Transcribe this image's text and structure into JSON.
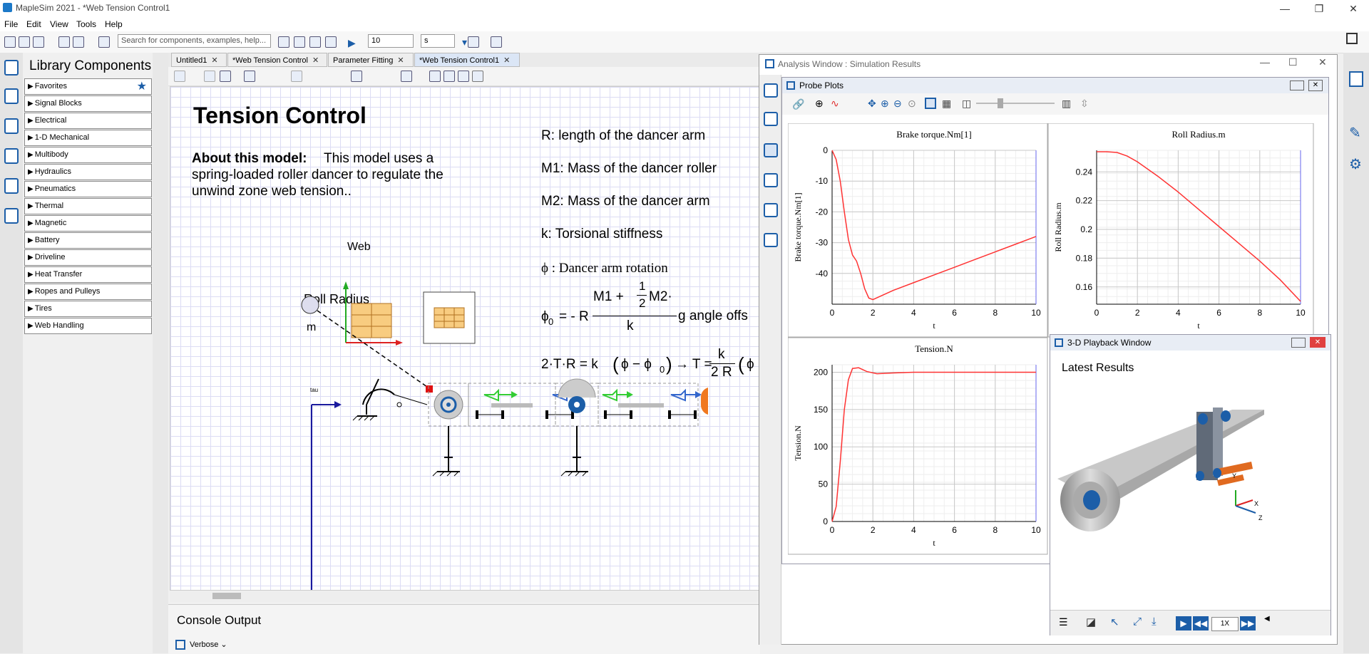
{
  "window": {
    "title": "MapleSim 2021 - *Web Tension Control1"
  },
  "menu": [
    "File",
    "Edit",
    "View",
    "Tools",
    "Help"
  ],
  "toolbar": {
    "search_placeholder": "Search for components, examples, help...",
    "sim_time": "10",
    "sim_units": "s"
  },
  "library": {
    "title": "Library Components",
    "items": [
      "Favorites",
      "Signal Blocks",
      "Electrical",
      "1-D Mechanical",
      "Multibody",
      "Hydraulics",
      "Pneumatics",
      "Thermal",
      "Magnetic",
      "Battery",
      "Driveline",
      "Heat Transfer",
      "Ropes and Pulleys",
      "Tires",
      "Web Handling"
    ]
  },
  "tabs": [
    {
      "label": "Untitled1",
      "close": "✕"
    },
    {
      "label": "*Web Tension Control",
      "close": "✕"
    },
    {
      "label": "Parameter Fitting",
      "close": "✕"
    },
    {
      "label": "*Web Tension Control1",
      "close": "✕"
    }
  ],
  "model": {
    "title": "Tension Control",
    "about_label": "About this model:",
    "about_line1": "This model uses a",
    "about_line2": "spring-loaded roller dancer to regulate the",
    "about_line3": "unwind zone web tension..",
    "defs": [
      "R: length of the dancer arm",
      "M1: Mass of the dancer roller",
      "M2: Mass of the dancer arm",
      "k: Torsional stiffness"
    ],
    "phi_def": "ϕ : Dancer arm rotation",
    "eq1_lhs": "ϕ",
    "eq1_sub": "0",
    "eq1_eq": "= - R",
    "eq1_num": "M1 +",
    "eq1_half_num": "1",
    "eq1_half_den": "2",
    "eq1_m2": "M2·",
    "eq1_den": "k",
    "eq1_tail": "g angle offs",
    "eq2_left": "2·T·R = k",
    "eq2_mid": "ϕ − ϕ",
    "eq2_sub": "0",
    "eq2_arrow": "→ T =",
    "eq2_frac_num": "k",
    "eq2_frac_den": "2 R",
    "eq2_tail": "ϕ",
    "web_label": "Web",
    "roll_radius_label": "Roll Radius",
    "m_label": "m",
    "tau_label": "tau"
  },
  "console": {
    "title": "Console Output",
    "verbose": "Verbose"
  },
  "analysis": {
    "title": "Analysis Window : Simulation Results",
    "probe_title": "Probe Plots"
  },
  "playback": {
    "title": "3-D Playback Window",
    "latest": "Latest Results",
    "speed": "1X",
    "axis_x": "X",
    "axis_y": "Y",
    "axis_z": "Z"
  },
  "colors": {
    "accent": "#1c5ea8",
    "curve": "#ff3333",
    "grid": "#dcdcf4"
  },
  "chart_data": [
    {
      "type": "line",
      "title": "Brake torque.Nm[1]",
      "xlabel": "t",
      "ylabel": "Brake torque.Nm[1]",
      "xlim": [
        0,
        10
      ],
      "ylim": [
        -50,
        0
      ],
      "xticks": [
        0,
        2,
        4,
        6,
        8,
        10
      ],
      "yticks": [
        0,
        -10,
        -20,
        -30,
        -40
      ],
      "x": [
        0,
        0.2,
        0.4,
        0.6,
        0.8,
        1.0,
        1.2,
        1.4,
        1.6,
        1.8,
        2.0,
        2.5,
        3,
        4,
        5,
        6,
        7,
        8,
        9,
        10
      ],
      "y": [
        0,
        -3,
        -10,
        -20,
        -29,
        -34,
        -36,
        -40,
        -45,
        -48,
        -48.5,
        -47,
        -45.5,
        -43,
        -40.5,
        -38,
        -35.5,
        -33,
        -30.5,
        -28
      ]
    },
    {
      "type": "line",
      "title": "Roll Radius.m",
      "xlabel": "t",
      "ylabel": "Roll Radius.m",
      "xlim": [
        0,
        10
      ],
      "ylim": [
        0.148,
        0.255
      ],
      "xticks": [
        0,
        2,
        4,
        6,
        8,
        10
      ],
      "yticks": [
        0.24,
        0.22,
        0.2,
        0.18,
        0.16
      ],
      "x": [
        0,
        0.5,
        1,
        1.5,
        2,
        3,
        4,
        5,
        6,
        7,
        8,
        9,
        10
      ],
      "y": [
        0.254,
        0.254,
        0.2535,
        0.251,
        0.247,
        0.237,
        0.226,
        0.214,
        0.202,
        0.19,
        0.178,
        0.165,
        0.15
      ]
    },
    {
      "type": "line",
      "title": "Tension.N",
      "xlabel": "t",
      "ylabel": "Tension.N",
      "xlim": [
        0,
        10
      ],
      "ylim": [
        0,
        210
      ],
      "xticks": [
        0,
        2,
        4,
        6,
        8,
        10
      ],
      "yticks": [
        200,
        150,
        100,
        50,
        0
      ],
      "x": [
        0,
        0.2,
        0.4,
        0.6,
        0.8,
        1.0,
        1.3,
        1.7,
        2.2,
        3,
        4,
        6,
        8,
        10
      ],
      "y": [
        0,
        20,
        80,
        150,
        190,
        205,
        206,
        201,
        198,
        199,
        200,
        200,
        200,
        200
      ]
    }
  ]
}
